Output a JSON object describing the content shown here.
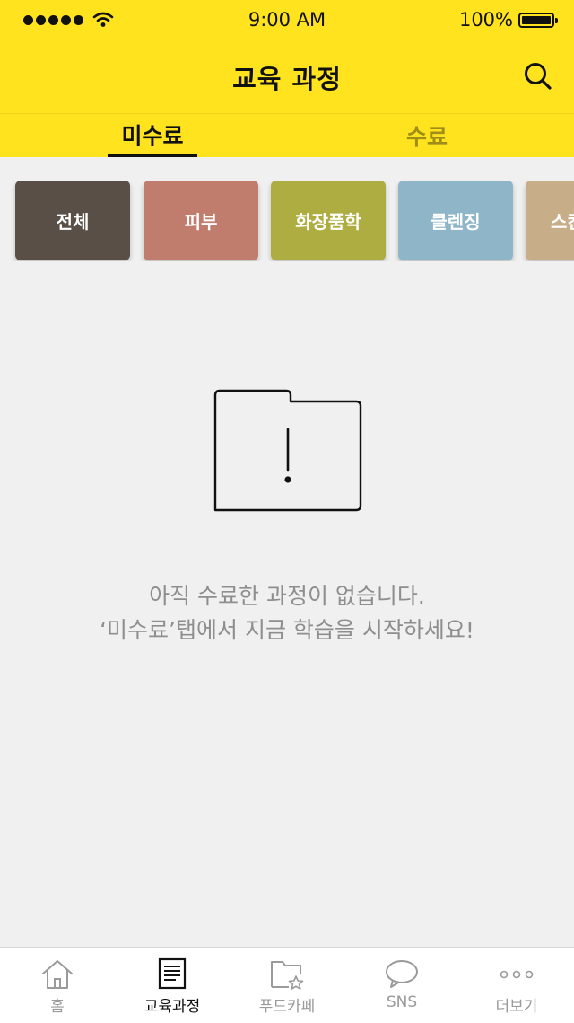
{
  "status_bar": {
    "time": "9:00 AM",
    "battery": "100%"
  },
  "header": {
    "title": "교육 과정"
  },
  "tabs": [
    {
      "label": "미수료",
      "active": true
    },
    {
      "label": "수료",
      "active": false
    }
  ],
  "categories": [
    {
      "label": "전체",
      "color": "#594f46"
    },
    {
      "label": "피부",
      "color": "#c07c6c"
    },
    {
      "label": "화장품학",
      "color": "#adad42"
    },
    {
      "label": "클렌징",
      "color": "#8fb6c8"
    },
    {
      "label": "스킨",
      "color": "#c8ad89"
    }
  ],
  "empty_state": {
    "icon": "folder-warning-icon",
    "line1": "아직 수료한 과정이 없습니다.",
    "line2": "‘미수료’탭에서 지금 학습을 시작하세요!"
  },
  "tab_bar": {
    "items": [
      {
        "label": "홈",
        "icon": "home-icon",
        "active": false
      },
      {
        "label": "교육과정",
        "icon": "document-icon",
        "active": true
      },
      {
        "label": "푸드카페",
        "icon": "folder-star-icon",
        "active": false
      },
      {
        "label": "SNS",
        "icon": "chat-bubble-icon",
        "active": false
      },
      {
        "label": "더보기",
        "icon": "more-dots-icon",
        "active": false
      }
    ]
  },
  "colors": {
    "brand_yellow": "#ffe31f",
    "background": "#f0f0f0"
  }
}
